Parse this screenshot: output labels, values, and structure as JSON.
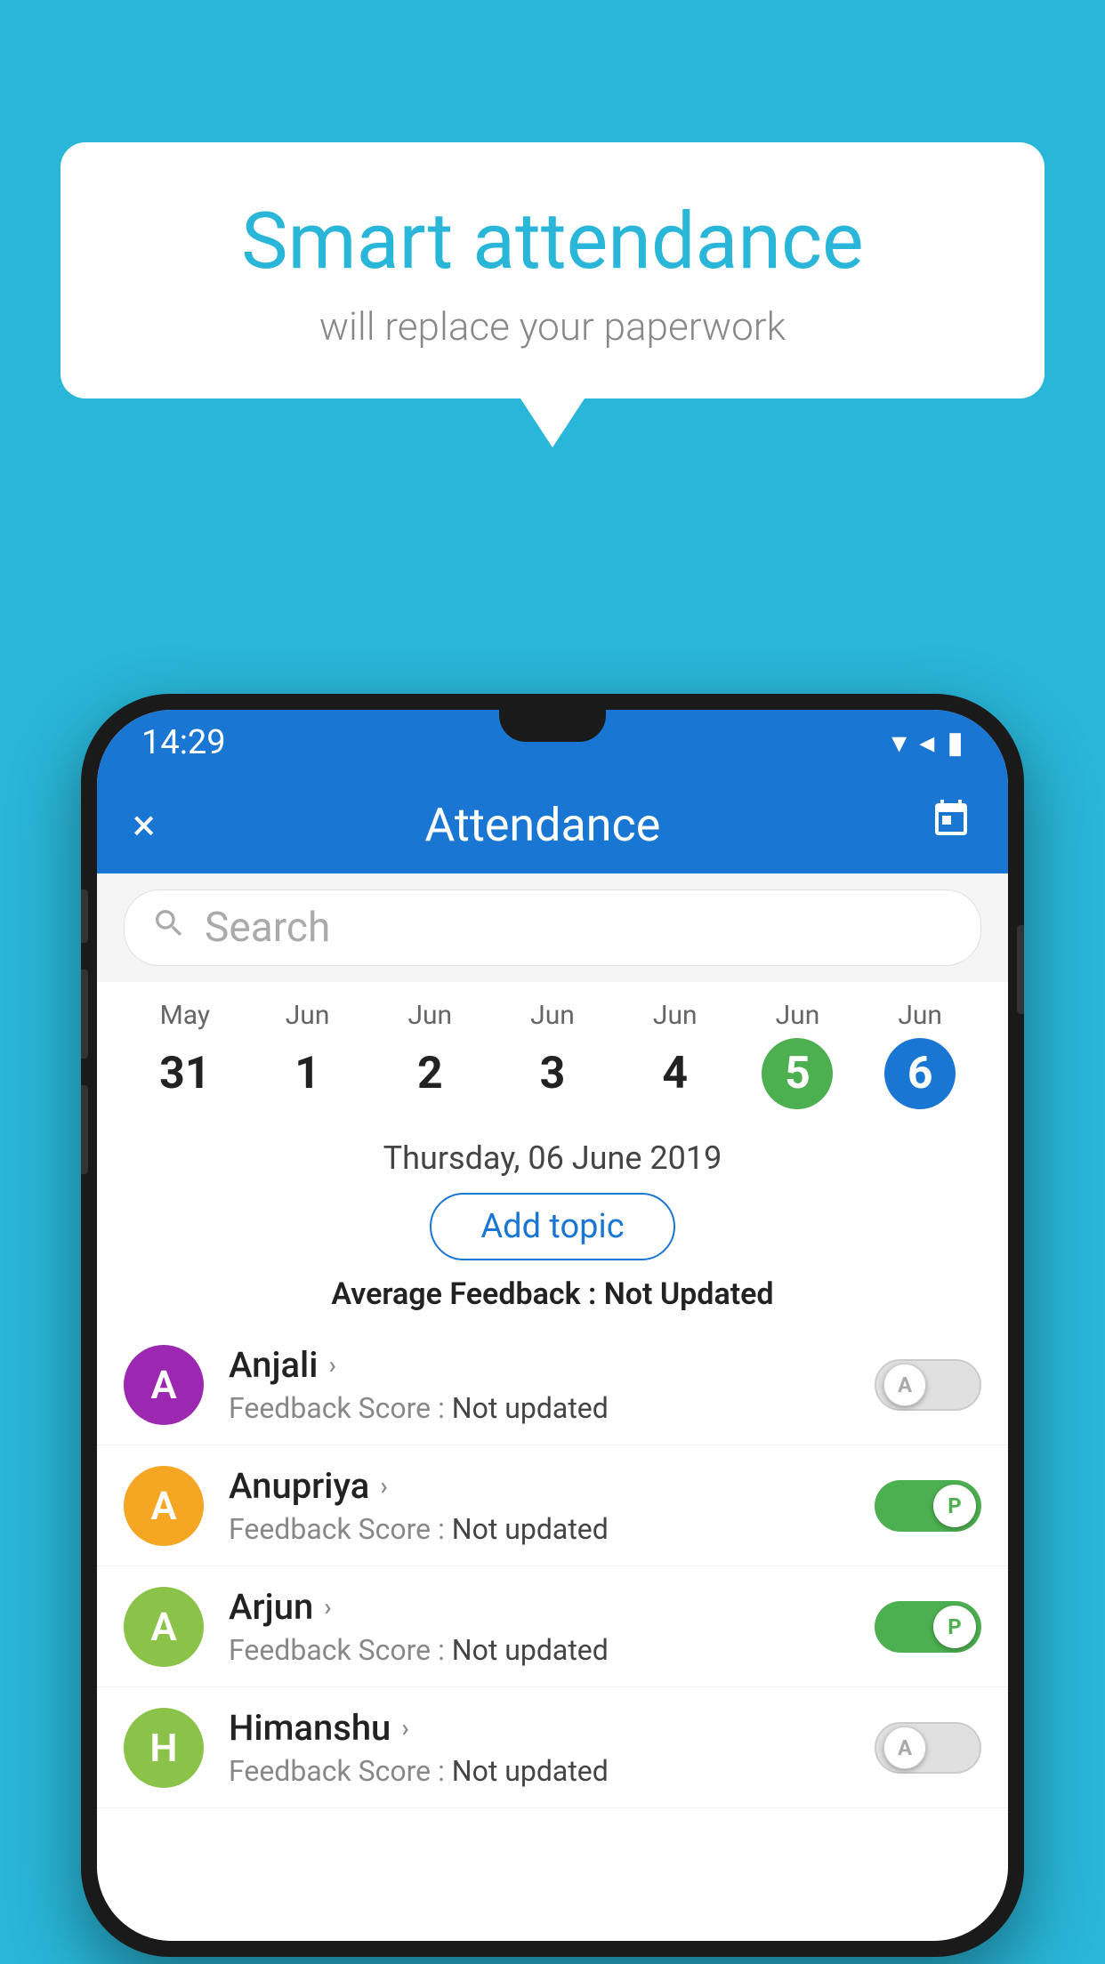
{
  "background_color": "#29b6d8",
  "bubble": {
    "title": "Smart attendance",
    "subtitle": "will replace your paperwork"
  },
  "phone": {
    "status_bar": {
      "time": "14:29",
      "icons": [
        "wifi",
        "signal",
        "battery"
      ]
    },
    "app_bar": {
      "title": "Attendance",
      "close_label": "×",
      "calendar_label": "📅"
    },
    "search": {
      "placeholder": "Search"
    },
    "calendar": {
      "days": [
        {
          "month": "May",
          "date": "31",
          "state": "normal"
        },
        {
          "month": "Jun",
          "date": "1",
          "state": "normal"
        },
        {
          "month": "Jun",
          "date": "2",
          "state": "normal"
        },
        {
          "month": "Jun",
          "date": "3",
          "state": "normal"
        },
        {
          "month": "Jun",
          "date": "4",
          "state": "normal"
        },
        {
          "month": "Jun",
          "date": "5",
          "state": "today"
        },
        {
          "month": "Jun",
          "date": "6",
          "state": "selected"
        }
      ]
    },
    "selected_date": "Thursday, 06 June 2019",
    "add_topic_label": "Add topic",
    "average_feedback_label": "Average Feedback :",
    "average_feedback_value": "Not Updated",
    "students": [
      {
        "name": "Anjali",
        "avatar_letter": "A",
        "avatar_color": "#9c27b0",
        "feedback_label": "Feedback Score :",
        "feedback_value": "Not updated",
        "attendance": "absent",
        "toggle_label": "A"
      },
      {
        "name": "Anupriya",
        "avatar_letter": "A",
        "avatar_color": "#f5a623",
        "feedback_label": "Feedback Score :",
        "feedback_value": "Not updated",
        "attendance": "present",
        "toggle_label": "P"
      },
      {
        "name": "Arjun",
        "avatar_letter": "A",
        "avatar_color": "#8bc34a",
        "feedback_label": "Feedback Score :",
        "feedback_value": "Not updated",
        "attendance": "present",
        "toggle_label": "P"
      },
      {
        "name": "Himanshu",
        "avatar_letter": "H",
        "avatar_color": "#8bc34a",
        "feedback_label": "Feedback Score :",
        "feedback_value": "Not updated",
        "attendance": "absent",
        "toggle_label": "A"
      }
    ]
  }
}
